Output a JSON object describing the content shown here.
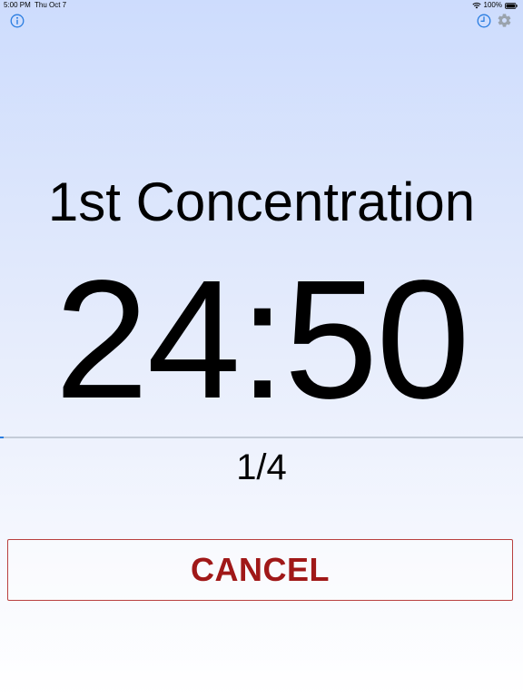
{
  "status_bar": {
    "time": "5:00 PM",
    "date": "Thu Oct 7",
    "battery": "100%"
  },
  "toolbar": {
    "info_icon": "info-icon",
    "history_icon": "clock-icon",
    "settings_icon": "gear-icon",
    "accent_color": "#2a7de1"
  },
  "timer": {
    "phase_title": "1st Concentration",
    "time_remaining": "24:50",
    "round": "1/4",
    "progress_fraction": 0.007
  },
  "actions": {
    "cancel_label": "CANCEL",
    "cancel_color": "#a01818"
  }
}
